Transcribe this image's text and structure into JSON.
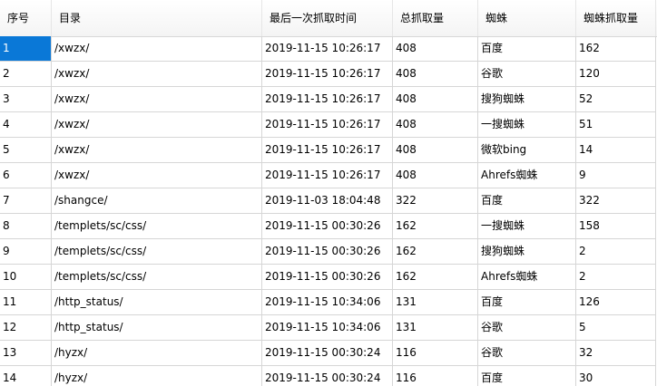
{
  "table": {
    "columns": [
      "序号",
      "目录",
      "最后一次抓取时间",
      "总抓取量",
      "蜘蛛",
      "蜘蛛抓取量"
    ],
    "rows": [
      [
        "1",
        "/xwzx/",
        "2019-11-15 10:26:17",
        "408",
        "百度",
        "162"
      ],
      [
        "2",
        "/xwzx/",
        "2019-11-15 10:26:17",
        "408",
        "谷歌",
        "120"
      ],
      [
        "3",
        "/xwzx/",
        "2019-11-15 10:26:17",
        "408",
        "搜狗蜘蛛",
        "52"
      ],
      [
        "4",
        "/xwzx/",
        "2019-11-15 10:26:17",
        "408",
        "一搜蜘蛛",
        "51"
      ],
      [
        "5",
        "/xwzx/",
        "2019-11-15 10:26:17",
        "408",
        "微软bing",
        "14"
      ],
      [
        "6",
        "/xwzx/",
        "2019-11-15 10:26:17",
        "408",
        "Ahrefs蜘蛛",
        "9"
      ],
      [
        "7",
        "/shangce/",
        "2019-11-03 18:04:48",
        "322",
        "百度",
        "322"
      ],
      [
        "8",
        "/templets/sc/css/",
        "2019-11-15 00:30:26",
        "162",
        "一搜蜘蛛",
        "158"
      ],
      [
        "9",
        "/templets/sc/css/",
        "2019-11-15 00:30:26",
        "162",
        "搜狗蜘蛛",
        "2"
      ],
      [
        "10",
        "/templets/sc/css/",
        "2019-11-15 00:30:26",
        "162",
        "Ahrefs蜘蛛",
        "2"
      ],
      [
        "11",
        "/http_status/",
        "2019-11-15 10:34:06",
        "131",
        "百度",
        "126"
      ],
      [
        "12",
        "/http_status/",
        "2019-11-15 10:34:06",
        "131",
        "谷歌",
        "5"
      ],
      [
        "13",
        "/hyzx/",
        "2019-11-15 00:30:24",
        "116",
        "谷歌",
        "32"
      ],
      [
        "14",
        "/hyzx/",
        "2019-11-15 00:30:24",
        "116",
        "百度",
        "30"
      ]
    ],
    "selected_cell": {
      "row": 0,
      "column": 0
    },
    "selection_color": "#0a78d7"
  }
}
